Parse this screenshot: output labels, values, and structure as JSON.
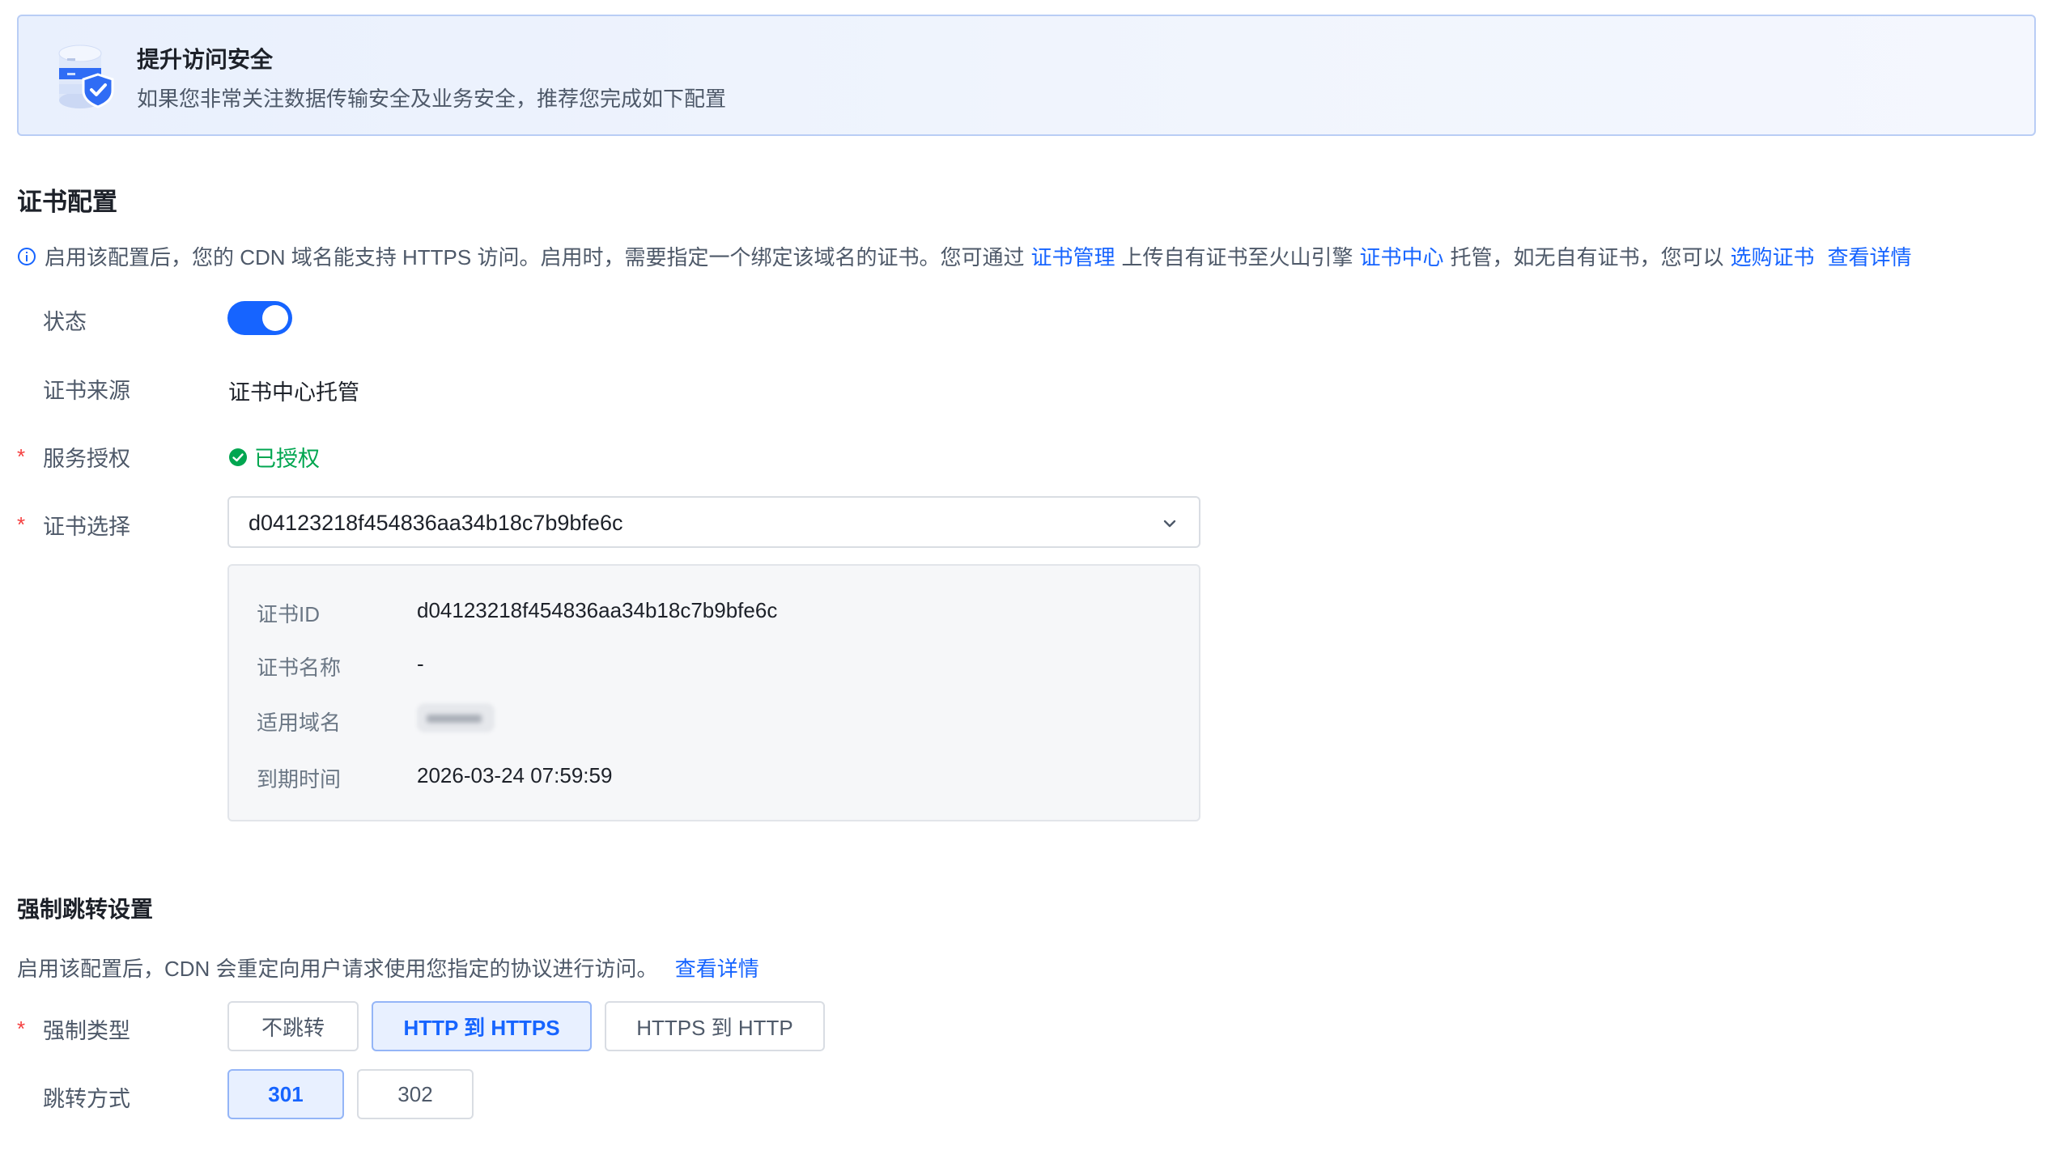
{
  "banner": {
    "title": "提升访问安全",
    "description": "如果您非常关注数据传输安全及业务安全，推荐您完成如下配置",
    "icon": "shield-database-icon"
  },
  "cert_section": {
    "title": "证书配置",
    "info_parts": {
      "text1": "启用该配置后，您的 CDN 域名能支持 HTTPS 访问。启用时，需要指定一个绑定该域名的证书。您可通过",
      "link_cert_manage": "证书管理",
      "text2": "上传自有证书至火山引擎",
      "link_cert_center": "证书中心",
      "text3": "托管，如无自有证书，您可以",
      "link_buy_cert": "选购证书",
      "link_details": "查看详情"
    },
    "status_label": "状态",
    "status_on": true,
    "source_label": "证书来源",
    "source_value": "证书中心托管",
    "auth_label": "服务授权",
    "auth_value": "已授权",
    "cert_select_label": "证书选择",
    "cert_select_value": "d04123218f454836aa34b18c7b9bfe6c",
    "details": {
      "id_label": "证书ID",
      "id_value": "d04123218f454836aa34b18c7b9bfe6c",
      "name_label": "证书名称",
      "name_value": "-",
      "domain_label": "适用域名",
      "expire_label": "到期时间",
      "expire_value": "2026-03-24 07:59:59"
    }
  },
  "redirect_section": {
    "title": "强制跳转设置",
    "description": "启用该配置后，CDN 会重定向用户请求使用您指定的协议进行访问。",
    "link_details": "查看详情",
    "type_label": "强制类型",
    "type_options": [
      "不跳转",
      "HTTP 到 HTTPS",
      "HTTPS 到 HTTP"
    ],
    "type_selected": "HTTP 到 HTTPS",
    "method_label": "跳转方式",
    "method_options": [
      "301",
      "302"
    ],
    "method_selected": "301"
  },
  "colors": {
    "primary": "#1664ff",
    "success": "#00a650",
    "required": "#f53f3f"
  }
}
